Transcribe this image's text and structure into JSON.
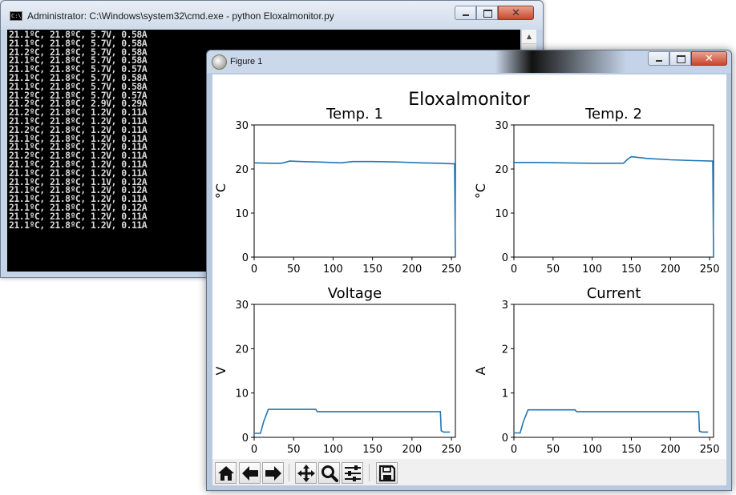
{
  "cmd": {
    "title": "Administrator: C:\\Windows\\system32\\cmd.exe - python  Eloxalmonitor.py",
    "lines": [
      "21.1ºC, 21.8ºC, 5.7V, 0.58A",
      "21.1ºC, 21.8ºC, 5.7V, 0.58A",
      "21.2ºC, 21.8ºC, 5.7V, 0.58A",
      "21.1ºC, 21.8ºC, 5.7V, 0.58A",
      "21.1ºC, 21.8ºC, 5.7V, 0.57A",
      "21.1ºC, 21.8ºC, 5.7V, 0.58A",
      "21.1ºC, 21.8ºC, 5.7V, 0.58A",
      "21.2ºC, 21.8ºC, 5.7V, 0.57A",
      "21.2ºC, 21.8ºC, 2.9V, 0.29A",
      "21.2ºC, 21.8ºC, 1.2V, 0.11A",
      "21.1ºC, 21.8ºC, 1.2V, 0.11A",
      "21.2ºC, 21.8ºC, 1.2V, 0.11A",
      "21.1ºC, 21.8ºC, 1.2V, 0.11A",
      "21.1ºC, 21.8ºC, 1.2V, 0.11A",
      "21.2ºC, 21.8ºC, 1.2V, 0.11A",
      "21.1ºC, 21.8ºC, 1.2V, 0.11A",
      "21.1ºC, 21.8ºC, 1.2V, 0.11A",
      "21.1ºC, 21.8ºC, 1.1V, 0.12A",
      "21.1ºC, 21.8ºC, 1.2V, 0.12A",
      "21.1ºC, 21.8ºC, 1.2V, 0.11A",
      "21.1ºC, 21.8ºC, 1.2V, 0.12A",
      "21.1ºC, 21.8ºC, 1.2V, 0.11A",
      "21.1ºC, 21.8ºC, 1.2V, 0.11A"
    ]
  },
  "figure": {
    "title": "Figure 1",
    "suptitle": "Eloxalmonitor",
    "toolbar": {
      "icons": [
        "home-icon",
        "back-arrow-icon",
        "forward-arrow-icon",
        "pan-icon",
        "zoom-icon",
        "configure-subplots-icon",
        "save-icon"
      ]
    }
  },
  "colors": {
    "line": "#1f77b4",
    "console_bg": "#000000",
    "console_fg": "#d9d9d9"
  },
  "chart_data": [
    {
      "type": "line",
      "title": "Temp. 1",
      "xlabel": "",
      "ylabel": "°C",
      "xlim": [
        0,
        255
      ],
      "ylim": [
        0,
        30
      ],
      "xticks": [
        0,
        50,
        100,
        150,
        200,
        250
      ],
      "yticks": [
        0,
        10,
        20,
        30
      ],
      "series": [
        {
          "x": [
            0,
            20,
            35,
            45,
            60,
            80,
            110,
            125,
            150,
            180,
            210,
            235,
            250,
            254,
            255
          ],
          "y": [
            21.4,
            21.3,
            21.3,
            21.8,
            21.7,
            21.6,
            21.4,
            21.7,
            21.7,
            21.6,
            21.4,
            21.3,
            21.2,
            21.2,
            0
          ]
        }
      ]
    },
    {
      "type": "line",
      "title": "Temp. 2",
      "xlabel": "",
      "ylabel": "°C",
      "xlim": [
        0,
        255
      ],
      "ylim": [
        0,
        30
      ],
      "xticks": [
        0,
        50,
        100,
        150,
        200,
        250
      ],
      "yticks": [
        0,
        10,
        20,
        30
      ],
      "series": [
        {
          "x": [
            0,
            30,
            60,
            100,
            140,
            145,
            150,
            170,
            200,
            230,
            253,
            254,
            255
          ],
          "y": [
            21.5,
            21.5,
            21.4,
            21.3,
            21.3,
            22.2,
            22.8,
            22.4,
            22.1,
            21.9,
            21.8,
            21.8,
            0
          ]
        }
      ]
    },
    {
      "type": "line",
      "title": "Voltage",
      "xlabel": "",
      "ylabel": "V",
      "xlim": [
        0,
        255
      ],
      "ylim": [
        0,
        30
      ],
      "xticks": [
        0,
        50,
        100,
        150,
        200,
        250
      ],
      "yticks": [
        0,
        10,
        20,
        30
      ],
      "series": [
        {
          "x": [
            0,
            8,
            12,
            18,
            25,
            50,
            78,
            80,
            120,
            160,
            200,
            236,
            237,
            240,
            248
          ],
          "y": [
            0.9,
            0.9,
            3.5,
            6.3,
            6.3,
            6.3,
            6.3,
            5.8,
            5.8,
            5.8,
            5.8,
            5.8,
            1.5,
            1.2,
            1.2
          ]
        }
      ]
    },
    {
      "type": "line",
      "title": "Current",
      "xlabel": "",
      "ylabel": "A",
      "xlim": [
        0,
        255
      ],
      "ylim": [
        0,
        3
      ],
      "xticks": [
        0,
        50,
        100,
        150,
        200,
        250
      ],
      "yticks": [
        0,
        1,
        2,
        3
      ],
      "series": [
        {
          "x": [
            0,
            8,
            12,
            18,
            25,
            50,
            78,
            80,
            120,
            160,
            200,
            236,
            237,
            240,
            248
          ],
          "y": [
            0.1,
            0.1,
            0.35,
            0.62,
            0.62,
            0.62,
            0.62,
            0.58,
            0.58,
            0.58,
            0.58,
            0.58,
            0.14,
            0.12,
            0.12
          ]
        }
      ]
    }
  ]
}
